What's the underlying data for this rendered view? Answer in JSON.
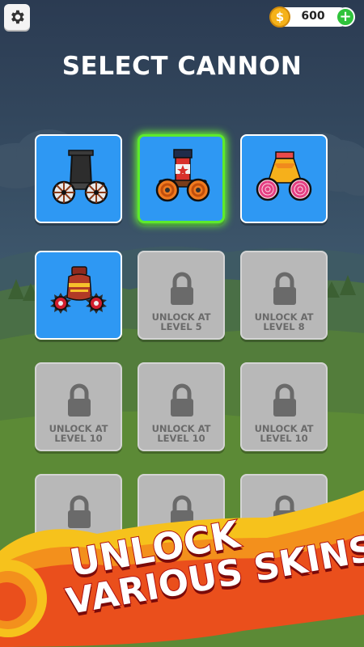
{
  "header": {
    "settings_icon": "gear-icon",
    "coins": "600",
    "coin_symbol": "$",
    "add_symbol": "+"
  },
  "title": "SELECT CANNON",
  "cards": [
    {
      "state": "unlocked",
      "cannon": "black-barrel-wheels",
      "selected": false
    },
    {
      "state": "unlocked",
      "cannon": "star-barrel-orange-wheels",
      "selected": true
    },
    {
      "state": "unlocked",
      "cannon": "candy-cone-lollipop-wheels",
      "selected": false
    },
    {
      "state": "unlocked",
      "cannon": "red-vase-spike-wheels",
      "selected": false
    },
    {
      "state": "locked",
      "line1": "UNLOCK AT",
      "line2": "LEVEL 5"
    },
    {
      "state": "locked",
      "line1": "UNLOCK AT",
      "line2": "LEVEL 8"
    },
    {
      "state": "locked",
      "line1": "UNLOCK AT",
      "line2": "LEVEL 10"
    },
    {
      "state": "locked",
      "line1": "UNLOCK AT",
      "line2": "LEVEL 10"
    },
    {
      "state": "locked",
      "line1": "UNLOCK AT",
      "line2": "LEVEL 10"
    },
    {
      "state": "locked"
    },
    {
      "state": "locked"
    },
    {
      "state": "locked"
    }
  ],
  "promo": {
    "line1": "UNLOCK",
    "line2": "VARIOUS SKINS!"
  },
  "colors": {
    "card_blue": "#2e98f3",
    "card_locked": "#b8b8b8",
    "selected_glow": "#5dea2c",
    "coin_gold": "#f5b21a",
    "plus_green": "#2fc33b"
  }
}
